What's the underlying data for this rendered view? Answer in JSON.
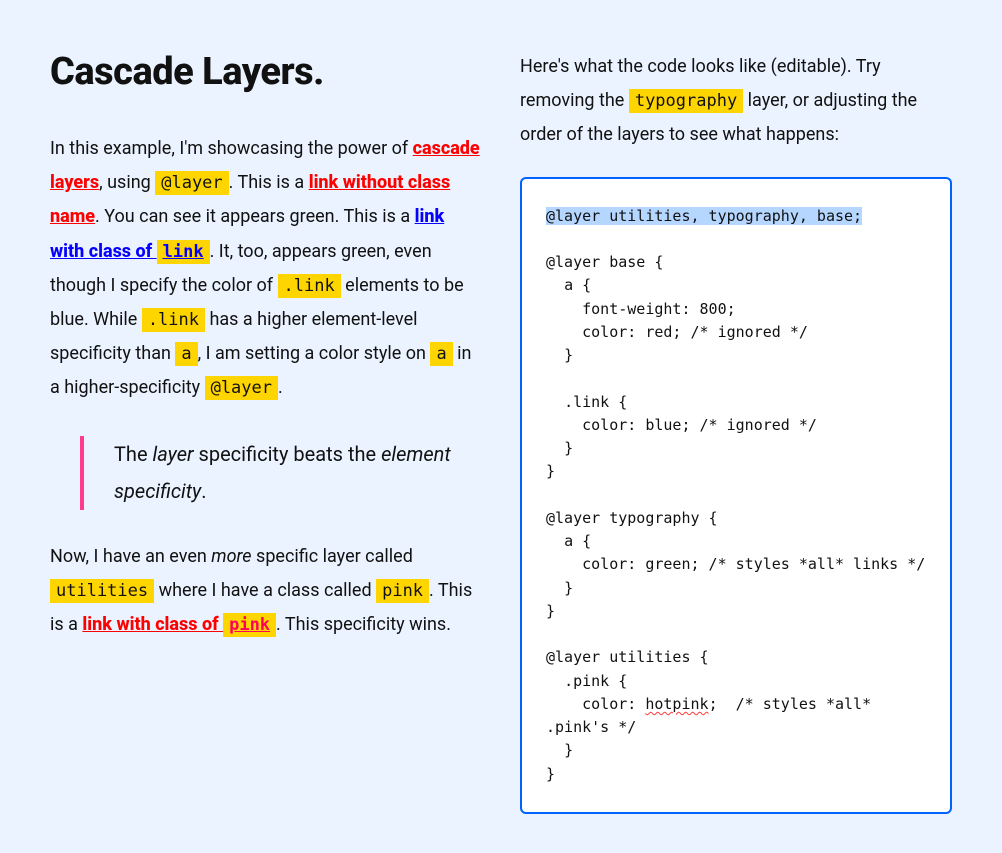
{
  "heading": "Cascade Layers.",
  "p1": {
    "t1": "In this example, I'm showcasing the power of ",
    "link1": "cascade layers",
    "t2": ", using ",
    "code1": "@layer",
    "t3": ". This is a ",
    "link2": "link without class name",
    "t4": ". You can see it appears green. This is a ",
    "link3a": "link with class of ",
    "link3b": "link",
    "t5": ". It, too, appears green, even though I specify the color of ",
    "code2": ".link",
    "t6": " elements to be blue. While ",
    "code3": ".link",
    "t7": " has a higher element-level specificity than ",
    "code4": "a",
    "t8": ", I am setting a color style on ",
    "code5": "a",
    "t9": " in a higher-specificity ",
    "code6": "@layer",
    "t10": "."
  },
  "quote": {
    "t1": "The ",
    "em1": "layer",
    "t2": " specificity beats the ",
    "em2": "element specificity",
    "t3": "."
  },
  "p2": {
    "t1": "Now, I have an even ",
    "em1": "more",
    "t2": " specific layer called ",
    "code1": "utilities",
    "t3": " where I have a class called ",
    "code2": "pink",
    "t4": ". This is a ",
    "link1a": "link with class of ",
    "link1b": "pink",
    "t5": ". This specificity wins."
  },
  "rightIntro": {
    "t1": "Here's what the code looks like (editable). Try removing the ",
    "code1": "typography",
    "t2": " layer, or adjusting the order of the layers to see what happens:"
  },
  "code": {
    "line1": "@layer utilities, typography, base;",
    "block1a": "@layer base {\n  a {\n    font-weight: 800;\n    color: red; /* ignored */\n  }\n\n  .link {\n    color: blue; /* ignored */\n  }\n}",
    "block2": "@layer typography {\n  a {\n    color: green; /* styles *all* links */\n  }\n}",
    "block3a": "@layer utilities {\n  .pink {\n    color: ",
    "block3b": "hotpink",
    "block3c": ";  /* styles *all* .pink's */\n  }\n}"
  }
}
